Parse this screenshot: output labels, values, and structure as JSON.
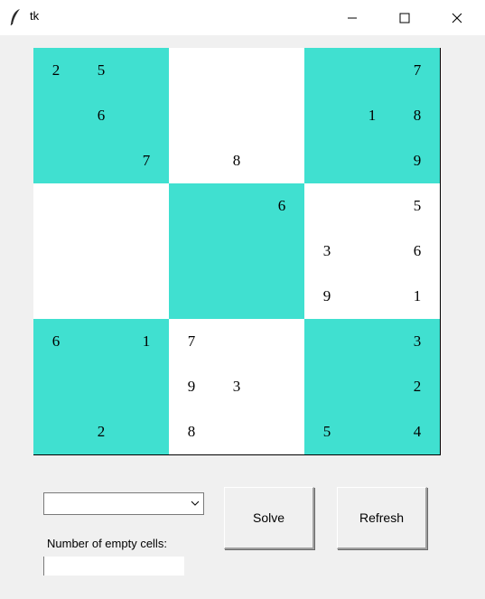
{
  "window": {
    "title": "tk",
    "icon": "feather-icon",
    "controls": [
      "minimize-icon",
      "maximize-icon",
      "close-icon"
    ]
  },
  "colors": {
    "shaded_cell": "#40e0d0",
    "plain_cell": "#ffffff"
  },
  "board": {
    "rows": [
      [
        "2",
        "5",
        "",
        "",
        "",
        "",
        "",
        "",
        "7"
      ],
      [
        "",
        "6",
        "",
        "",
        "",
        "",
        "",
        "1",
        "8"
      ],
      [
        "",
        "",
        "7",
        "",
        "8",
        "",
        "",
        "",
        "9"
      ],
      [
        "",
        "",
        "",
        "",
        "",
        "6",
        "",
        "",
        "5"
      ],
      [
        "",
        "",
        "",
        "",
        "",
        "",
        "3",
        "",
        "6"
      ],
      [
        "",
        "",
        "",
        "",
        "",
        "",
        "9",
        "",
        "1"
      ],
      [
        "6",
        "",
        "1",
        "7",
        "",
        "",
        "",
        "",
        "3"
      ],
      [
        "",
        "",
        "",
        "9",
        "3",
        "",
        "",
        "",
        "2"
      ],
      [
        "",
        "2",
        "",
        "8",
        "",
        "",
        "5",
        "",
        "4"
      ]
    ],
    "shaded_boxes": [
      [
        true,
        false,
        true
      ],
      [
        false,
        true,
        false
      ],
      [
        true,
        false,
        true
      ]
    ]
  },
  "controls": {
    "difficulty_select": {
      "selected": ""
    },
    "solve_label": "Solve",
    "refresh_label": "Refresh",
    "empty_cells_label": "Number of empty cells:",
    "empty_cells_value": ""
  }
}
